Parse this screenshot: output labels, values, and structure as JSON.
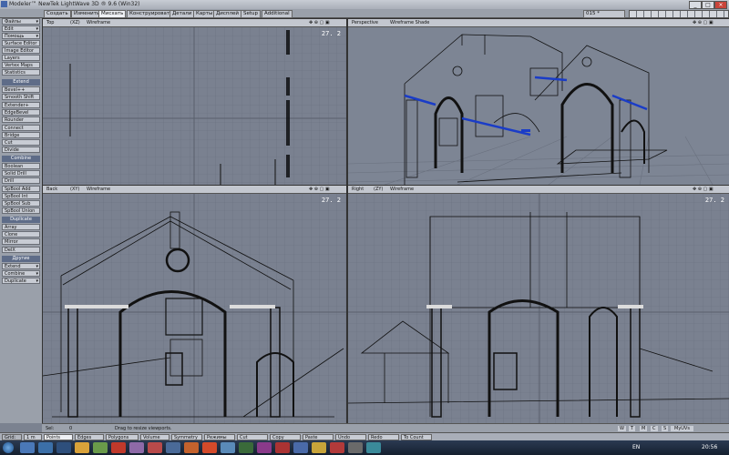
{
  "window": {
    "title": "Modeler™ NewTek LightWave 3D ® 9.6  (Win32)",
    "min": "_",
    "max": "□",
    "close": "×"
  },
  "tabs": [
    {
      "label": "Создать"
    },
    {
      "label": "Изменить"
    },
    {
      "label": "Мисхать"
    },
    {
      "label": "Конструировать"
    },
    {
      "label": "Детали"
    },
    {
      "label": "Карты"
    },
    {
      "label": "Дисплей"
    },
    {
      "label": "Setup"
    },
    {
      "label": "Additional"
    }
  ],
  "toolbar_right": {
    "layer_field": "015 *"
  },
  "left_panel": {
    "top_buttons": [
      "Файлы",
      "Edit",
      "Помощь",
      "Surface Editor",
      "Image Editor",
      "Layers",
      "Vertex Maps",
      "Statistics"
    ],
    "extend_header": "Extend",
    "extend_buttons": [
      "Bevel++",
      "Smooth Shift",
      "Extender+",
      "EdgeBevel",
      "Rounder",
      "Connect",
      "Bridge",
      "Cut",
      "Divide"
    ],
    "combine_header": "Combine",
    "combine_buttons": [
      "Boolean",
      "Solid Drill",
      "Drill",
      "SpBool Add",
      "SpBool Int",
      "SpBool Sub",
      "SpBool Union"
    ],
    "duplicate_header": "Duplicate",
    "duplicate_buttons": [
      "Array",
      "Clone",
      "Mirror",
      "DelX"
    ],
    "other_header": "Другие",
    "other_buttons": [
      "Extend",
      "Combine",
      "Duplicate"
    ]
  },
  "viewports": {
    "top": {
      "view": "Top",
      "axes": "(XZ)",
      "shade": "Wireframe",
      "zoom": "27. 2"
    },
    "perspective": {
      "view": "Perspective",
      "shade": "Wireframe Shade",
      "zoom": ""
    },
    "back": {
      "view": "Back",
      "axes": "(XY)",
      "shade": "Wireframe",
      "zoom": "27. 2"
    },
    "right": {
      "view": "Right",
      "axes": "(ZY)",
      "shade": "Wireframe",
      "zoom": "27. 2"
    }
  },
  "status": {
    "sel_label": "Sel:",
    "sel_value": "0",
    "message": "Drag to resize viewports.",
    "grid_label": "Grid:",
    "grid_value": "1 m"
  },
  "status_right": {
    "w": "W",
    "t": "T",
    "m": "M",
    "c": "C",
    "s": "S",
    "vmap": "MyUVs"
  },
  "modes": [
    "Points",
    "Edges",
    "Polygons",
    "Volume",
    "Symmetry",
    "Режимы",
    "Cut",
    "Copy",
    "Paste",
    "Undo",
    "Redo",
    "To Count"
  ],
  "taskbar": {
    "lang": "EN",
    "time": "20:56"
  }
}
